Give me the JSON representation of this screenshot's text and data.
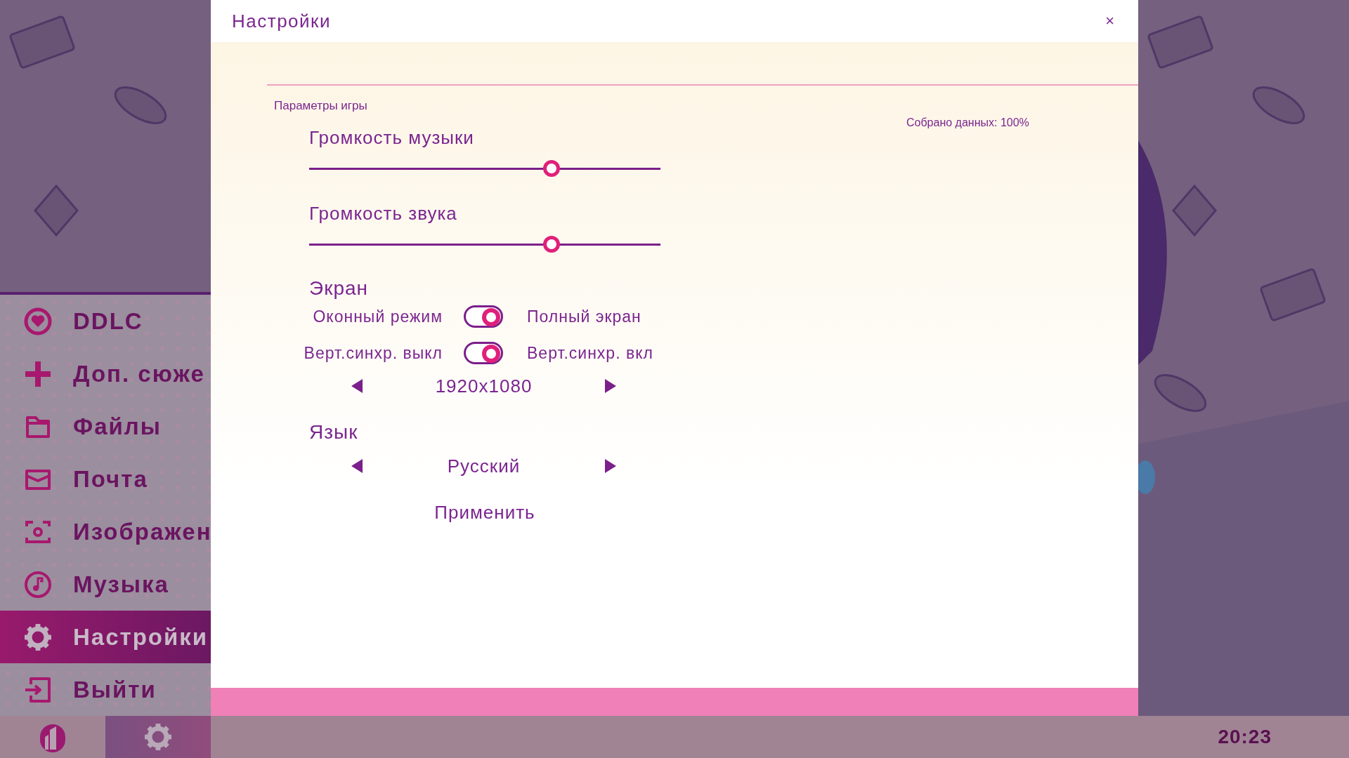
{
  "sidebar": {
    "items": [
      {
        "label": "DDLC",
        "selected": false
      },
      {
        "label": "Доп. сюже",
        "selected": false
      },
      {
        "label": "Файлы",
        "selected": false
      },
      {
        "label": "Почта",
        "selected": false
      },
      {
        "label": "Изображен",
        "selected": false
      },
      {
        "label": "Музыка",
        "selected": false
      },
      {
        "label": "Настройки",
        "selected": true
      },
      {
        "label": "Выйти",
        "selected": false
      }
    ]
  },
  "dialog": {
    "title": "Настройки",
    "close": "×",
    "section": "Параметры игры",
    "data_collected": "Собрано данных: 100%",
    "sliders": [
      {
        "label": "Громкость музыки",
        "level": 0.69
      },
      {
        "label": "Громкость звука",
        "level": 0.69
      }
    ],
    "display": {
      "heading": "Экран",
      "toggles": [
        {
          "off_label": "Оконный режим",
          "on_label": "Полный экран",
          "on": true
        },
        {
          "off_label": "Верт.синхр. выкл",
          "on_label": "Верт.синхр. вкл",
          "on": true
        }
      ],
      "resolution": "1920x1080"
    },
    "language": {
      "heading": "Язык",
      "value": "Русский"
    },
    "apply": "Применить"
  },
  "bottom_bar": {
    "tabs": [
      {
        "selected": false
      },
      {
        "selected": true
      }
    ],
    "clock": "20:23"
  }
}
